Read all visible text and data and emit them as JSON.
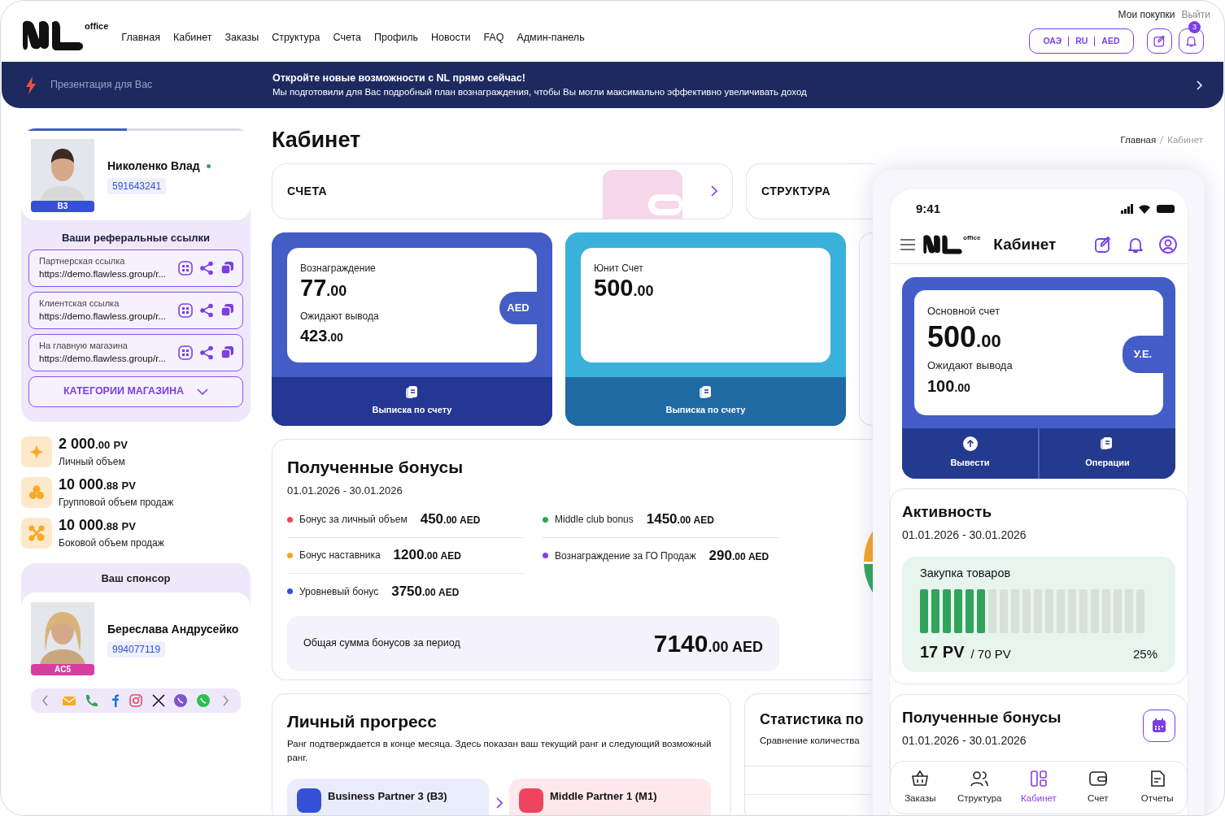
{
  "header": {
    "logo_text": "office",
    "nav": [
      "Главная",
      "Кабинет",
      "Заказы",
      "Структура",
      "Счета",
      "Профиль",
      "Новости",
      "FAQ",
      "Админ-панель"
    ],
    "top_links": [
      "Мои покупки",
      "Выйти"
    ],
    "locale": [
      "ОАЭ",
      "RU",
      "AED"
    ],
    "notifications": "3"
  },
  "banner": {
    "label": "Презентация для Вас",
    "title": "Откройте новые возможности с NL прямо сейчас!",
    "text": "Мы подготовили для Вас подробный план вознаграждения, чтобы Вы могли максимально эффективно увеличивать доход"
  },
  "profile": {
    "name": "Николенко Влад",
    "online": true,
    "id": "591643241",
    "rank": "B3",
    "level": 0.46,
    "referral_title": "Ваши реферальные ссылки",
    "links": [
      {
        "label": "Партнерская ссылка",
        "url": "https://demo.flawless.group/r..."
      },
      {
        "label": "Клиентская ссылка",
        "url": "https://demo.flawless.group/r..."
      },
      {
        "label": "На главную магазина",
        "url": "https://demo.flawless.group/r..."
      }
    ],
    "categories_button": "КАТЕГОРИИ МАГАЗИНА"
  },
  "volumes": [
    {
      "kind": "star",
      "amount": "2 000",
      "decimals": ".00",
      "unit": "PV",
      "label": "Личный объем"
    },
    {
      "kind": "circles",
      "amount": "10 000",
      "decimals": ".88",
      "unit": "PV",
      "label": "Групповой объем продаж"
    },
    {
      "kind": "nodes",
      "amount": "10 000",
      "decimals": ".88",
      "unit": "PV",
      "label": "Боковой объем продаж"
    }
  ],
  "sponsor": {
    "title": "Ваш спонсор",
    "name": "Береслава Андрусейко",
    "id": "994077119",
    "rank": "AC5"
  },
  "page": {
    "title": "Кабинет",
    "breadcrumbs": [
      {
        "label": "Главная",
        "selected": false
      },
      {
        "label": "Кабинет",
        "selected": true
      }
    ]
  },
  "quick_links": [
    "СЧЕТА",
    "СТРУКТУРА"
  ],
  "accounts": [
    {
      "label": "Вознаграждение",
      "amount": "77",
      "decimals": ".00",
      "pending_label": "Ожидают вывода",
      "pending": "423",
      "pending_decimals": ".00",
      "currency": "AED",
      "action": "Выписка по счету",
      "color": "#435cc6"
    },
    {
      "label": "Юнит Счет",
      "amount": "500",
      "decimals": ".00",
      "action": "Выписка по счету",
      "color": "#3ab1da"
    }
  ],
  "bonuses": {
    "title": "Полученные бонусы",
    "period": "01.01.2026 - 30.01.2026",
    "items": [
      {
        "label": "Бонус за личный объем",
        "amount": "450",
        "decimals": ".00",
        "currency": "AED",
        "color": "#ef4460"
      },
      {
        "label": "Middle club bonus",
        "amount": "1450",
        "decimals": ".00",
        "currency": "AED",
        "color": "#2ea65a"
      },
      {
        "label": "Бонус наставника",
        "amount": "1200",
        "decimals": ".00",
        "currency": "AED",
        "color": "#f5a623"
      },
      {
        "label": "Вознаграждение за ГО Продаж",
        "amount": "290",
        "decimals": ".00",
        "currency": "AED",
        "color": "#8a3fe0"
      },
      {
        "label": "Уровневый бонус",
        "amount": "3750",
        "decimals": ".00",
        "currency": "AED",
        "color": "#3650d8"
      }
    ],
    "total_label": "Общая сумма бонусов за период",
    "total": "7140",
    "total_decimals": ".00",
    "total_currency": "AED"
  },
  "progress": {
    "title": "Личный прогресс",
    "text": "Ранг подтверждается в конце месяца. Здесь показан ваш текущий ранг и следующий возможный ранг.",
    "ranks": [
      {
        "name": "Business Partner 3 (B3)",
        "color": "#3650d8"
      },
      {
        "name": "Middle Partner 1 (M1)",
        "color": "#ef4460"
      }
    ]
  },
  "statistics": {
    "title": "Статистика по",
    "subtitle": "Сравнение количества"
  },
  "phone": {
    "time": "9:41",
    "logo_text": "office",
    "title": "Кабинет",
    "account": {
      "label": "Основной счет",
      "amount": "500",
      "decimals": ".00",
      "pending_label": "Ожидают вывода",
      "pending": "100",
      "pending_decimals": ".00",
      "currency": "У.Е."
    },
    "actions": [
      {
        "kind": "withdraw",
        "label": "Вывести"
      },
      {
        "kind": "operations",
        "label": "Операции"
      }
    ],
    "activity": {
      "title": "Активность",
      "period": "01.01.2026 - 30.01.2026",
      "label": "Закупка товаров",
      "current": "17 PV",
      "target": "/ 70 PV",
      "percent": "25%",
      "level": 0.3
    },
    "bonuses": {
      "title": "Полученные бонусы",
      "period": "01.01.2026 - 30.01.2026"
    },
    "tabs": [
      {
        "kind": "orders",
        "label": "Заказы",
        "selected": false
      },
      {
        "kind": "structure",
        "label": "Структура",
        "selected": false
      },
      {
        "kind": "cabinet",
        "label": "Кабинет",
        "selected": true
      },
      {
        "kind": "account",
        "label": "Счет",
        "selected": false
      },
      {
        "kind": "reports",
        "label": "Отчеты",
        "selected": false
      }
    ]
  }
}
